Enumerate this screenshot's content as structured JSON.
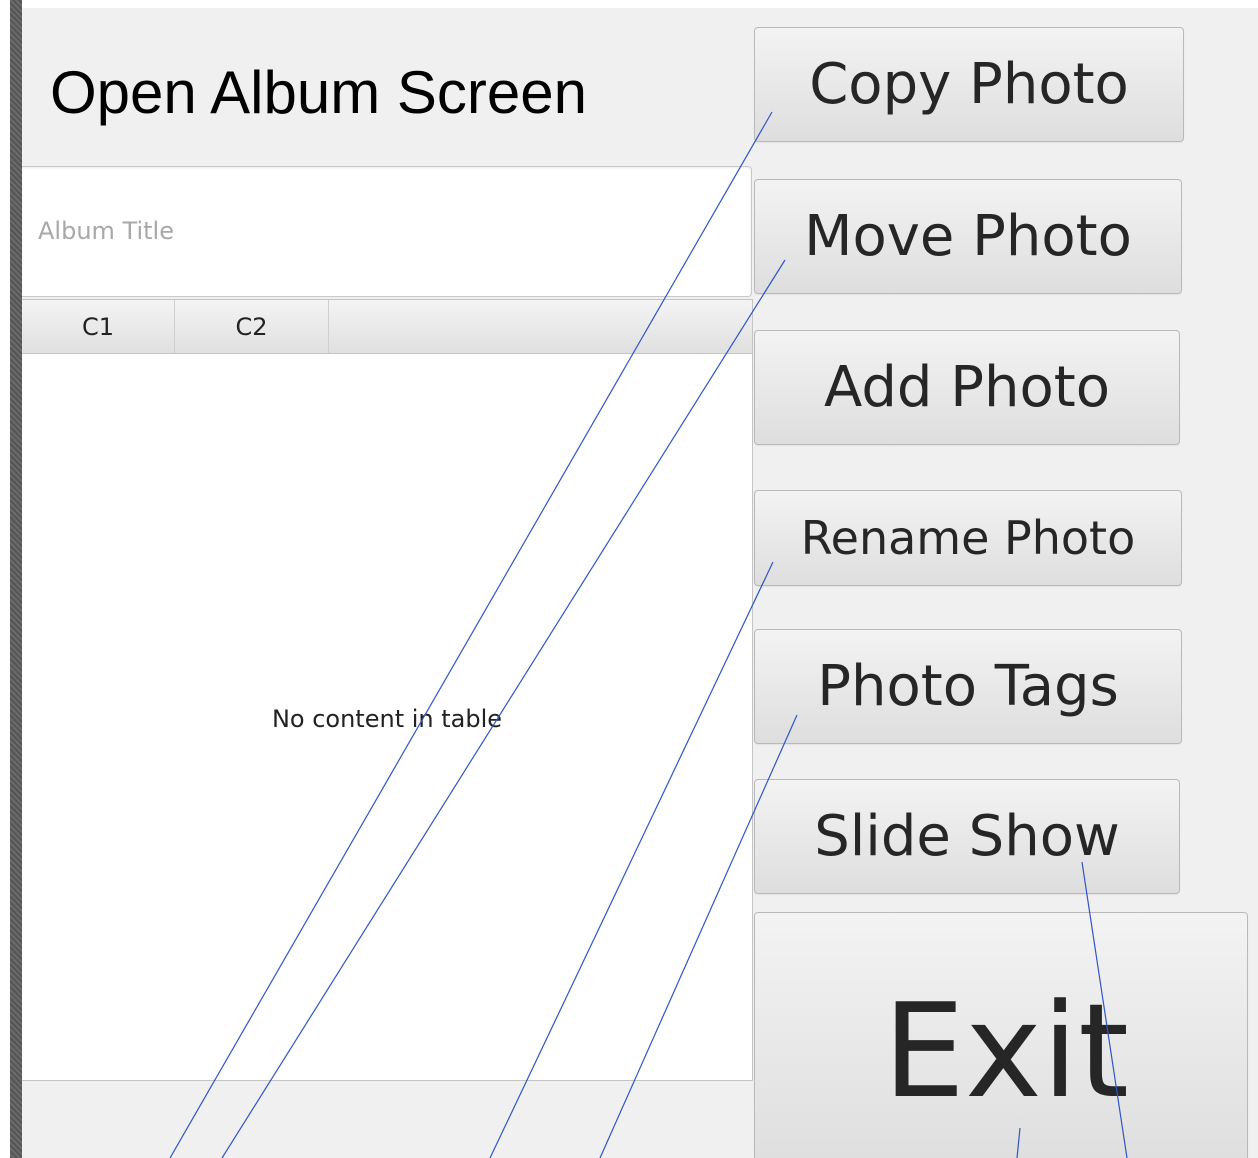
{
  "window": {
    "title": "Open Album Screen"
  },
  "album_title_field": {
    "value": "",
    "placeholder": "Album Title"
  },
  "table": {
    "columns": [
      "C1",
      "C2"
    ],
    "placeholder": "No content in table"
  },
  "buttons": {
    "copy_photo": "Copy Photo",
    "move_photo": "Move Photo",
    "add_photo": "Add Photo",
    "rename_photo": "Rename Photo",
    "photo_tags": "Photo Tags",
    "slide_show": "Slide Show",
    "exit": "Exit"
  },
  "colors": {
    "background": "#f0f0f0",
    "annotation_line": "#2f55c8"
  }
}
